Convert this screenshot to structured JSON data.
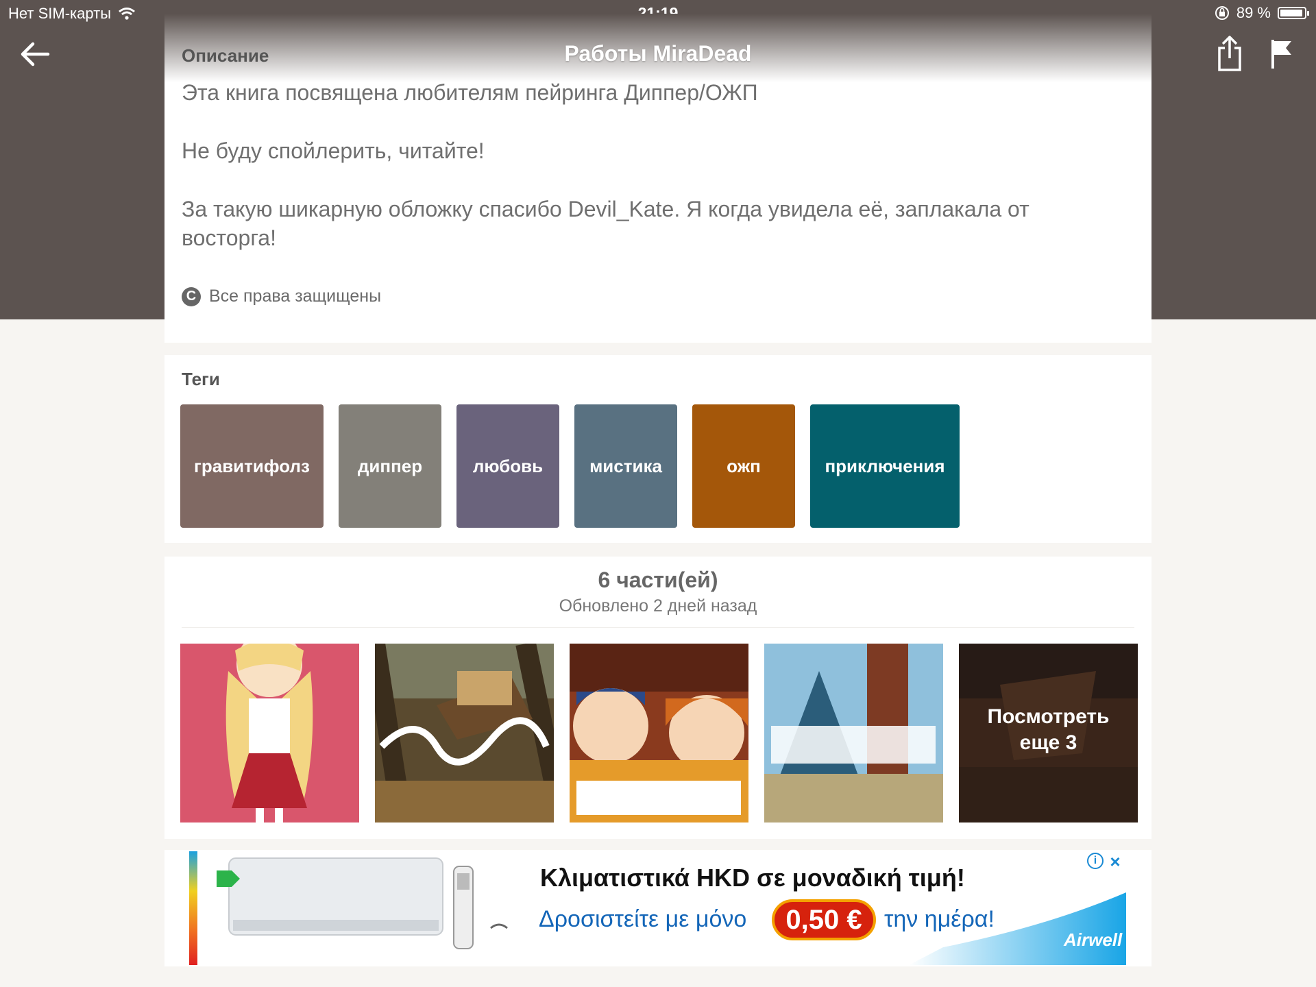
{
  "status_bar": {
    "carrier": "Нет SIM-карты",
    "time": "21:19",
    "battery": "89 %",
    "battery_level": 0.89
  },
  "nav": {
    "title": "Работы MiraDead"
  },
  "description": {
    "heading": "Описание",
    "paragraphs": [
      "Эта книга посвящена любителям пейринга Диппер/ОЖП",
      "Не буду спойлерить, читайте!",
      "За такую шикарную обложку спасибо Devil_Kate. Я когда увидела её, заплакала от восторга!"
    ],
    "copyright_icon": "copyright-icon",
    "copyright": "Все права защищены"
  },
  "tags": {
    "heading": "Теги",
    "items": [
      {
        "label": "гравитифолз",
        "color": "#806963"
      },
      {
        "label": "диппер",
        "color": "#838079"
      },
      {
        "label": "любовь",
        "color": "#6a637c"
      },
      {
        "label": "мистика",
        "color": "#597181"
      },
      {
        "label": "ожп",
        "color": "#a4570a"
      },
      {
        "label": "приключения",
        "color": "#04606c"
      }
    ]
  },
  "parts": {
    "count": "6 части(ей)",
    "updated": "Обновлено 2 дней назад",
    "more": "Посмотреть еще 3"
  },
  "ad": {
    "headline": "Κλιματιστικά HKD σε μοναδική τιμή!",
    "sub1": "Δροσιστείτε με μόνο",
    "price": "0,50 €",
    "sub2": "την ημέρα!",
    "brand": "Airwell"
  },
  "colors": {
    "hero": "#5c5350",
    "page_bg": "#f7f5f2",
    "link_blue": "#1466b8",
    "price_red": "#d6220d"
  }
}
